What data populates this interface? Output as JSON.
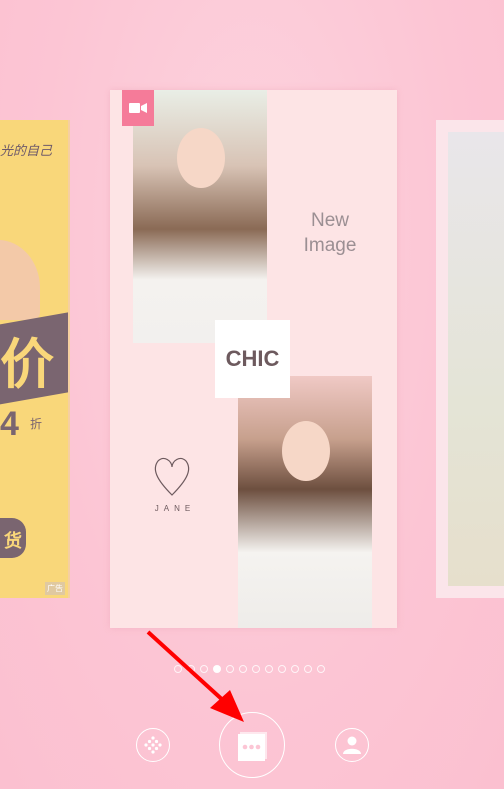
{
  "left_card": {
    "slogan": "光的自己",
    "price": "价",
    "discount": "4",
    "zhe": "折",
    "buy": "货",
    "ad": "广告"
  },
  "main_card": {
    "new_image": "New Image",
    "chic": "CHIC",
    "jane": "JANE",
    "video_icon": "video-camera-icon"
  },
  "pager": {
    "total": 12,
    "active_index": 3
  },
  "toolbar": {
    "left_icon": "dots-grid-icon",
    "center_icon": "templates-icon",
    "right_icon": "user-profile-icon"
  },
  "annotation": {
    "color": "#ff0000"
  },
  "colors": {
    "background": "#fcc6d5",
    "accent": "#f57b99",
    "card": "#fde4e5"
  }
}
